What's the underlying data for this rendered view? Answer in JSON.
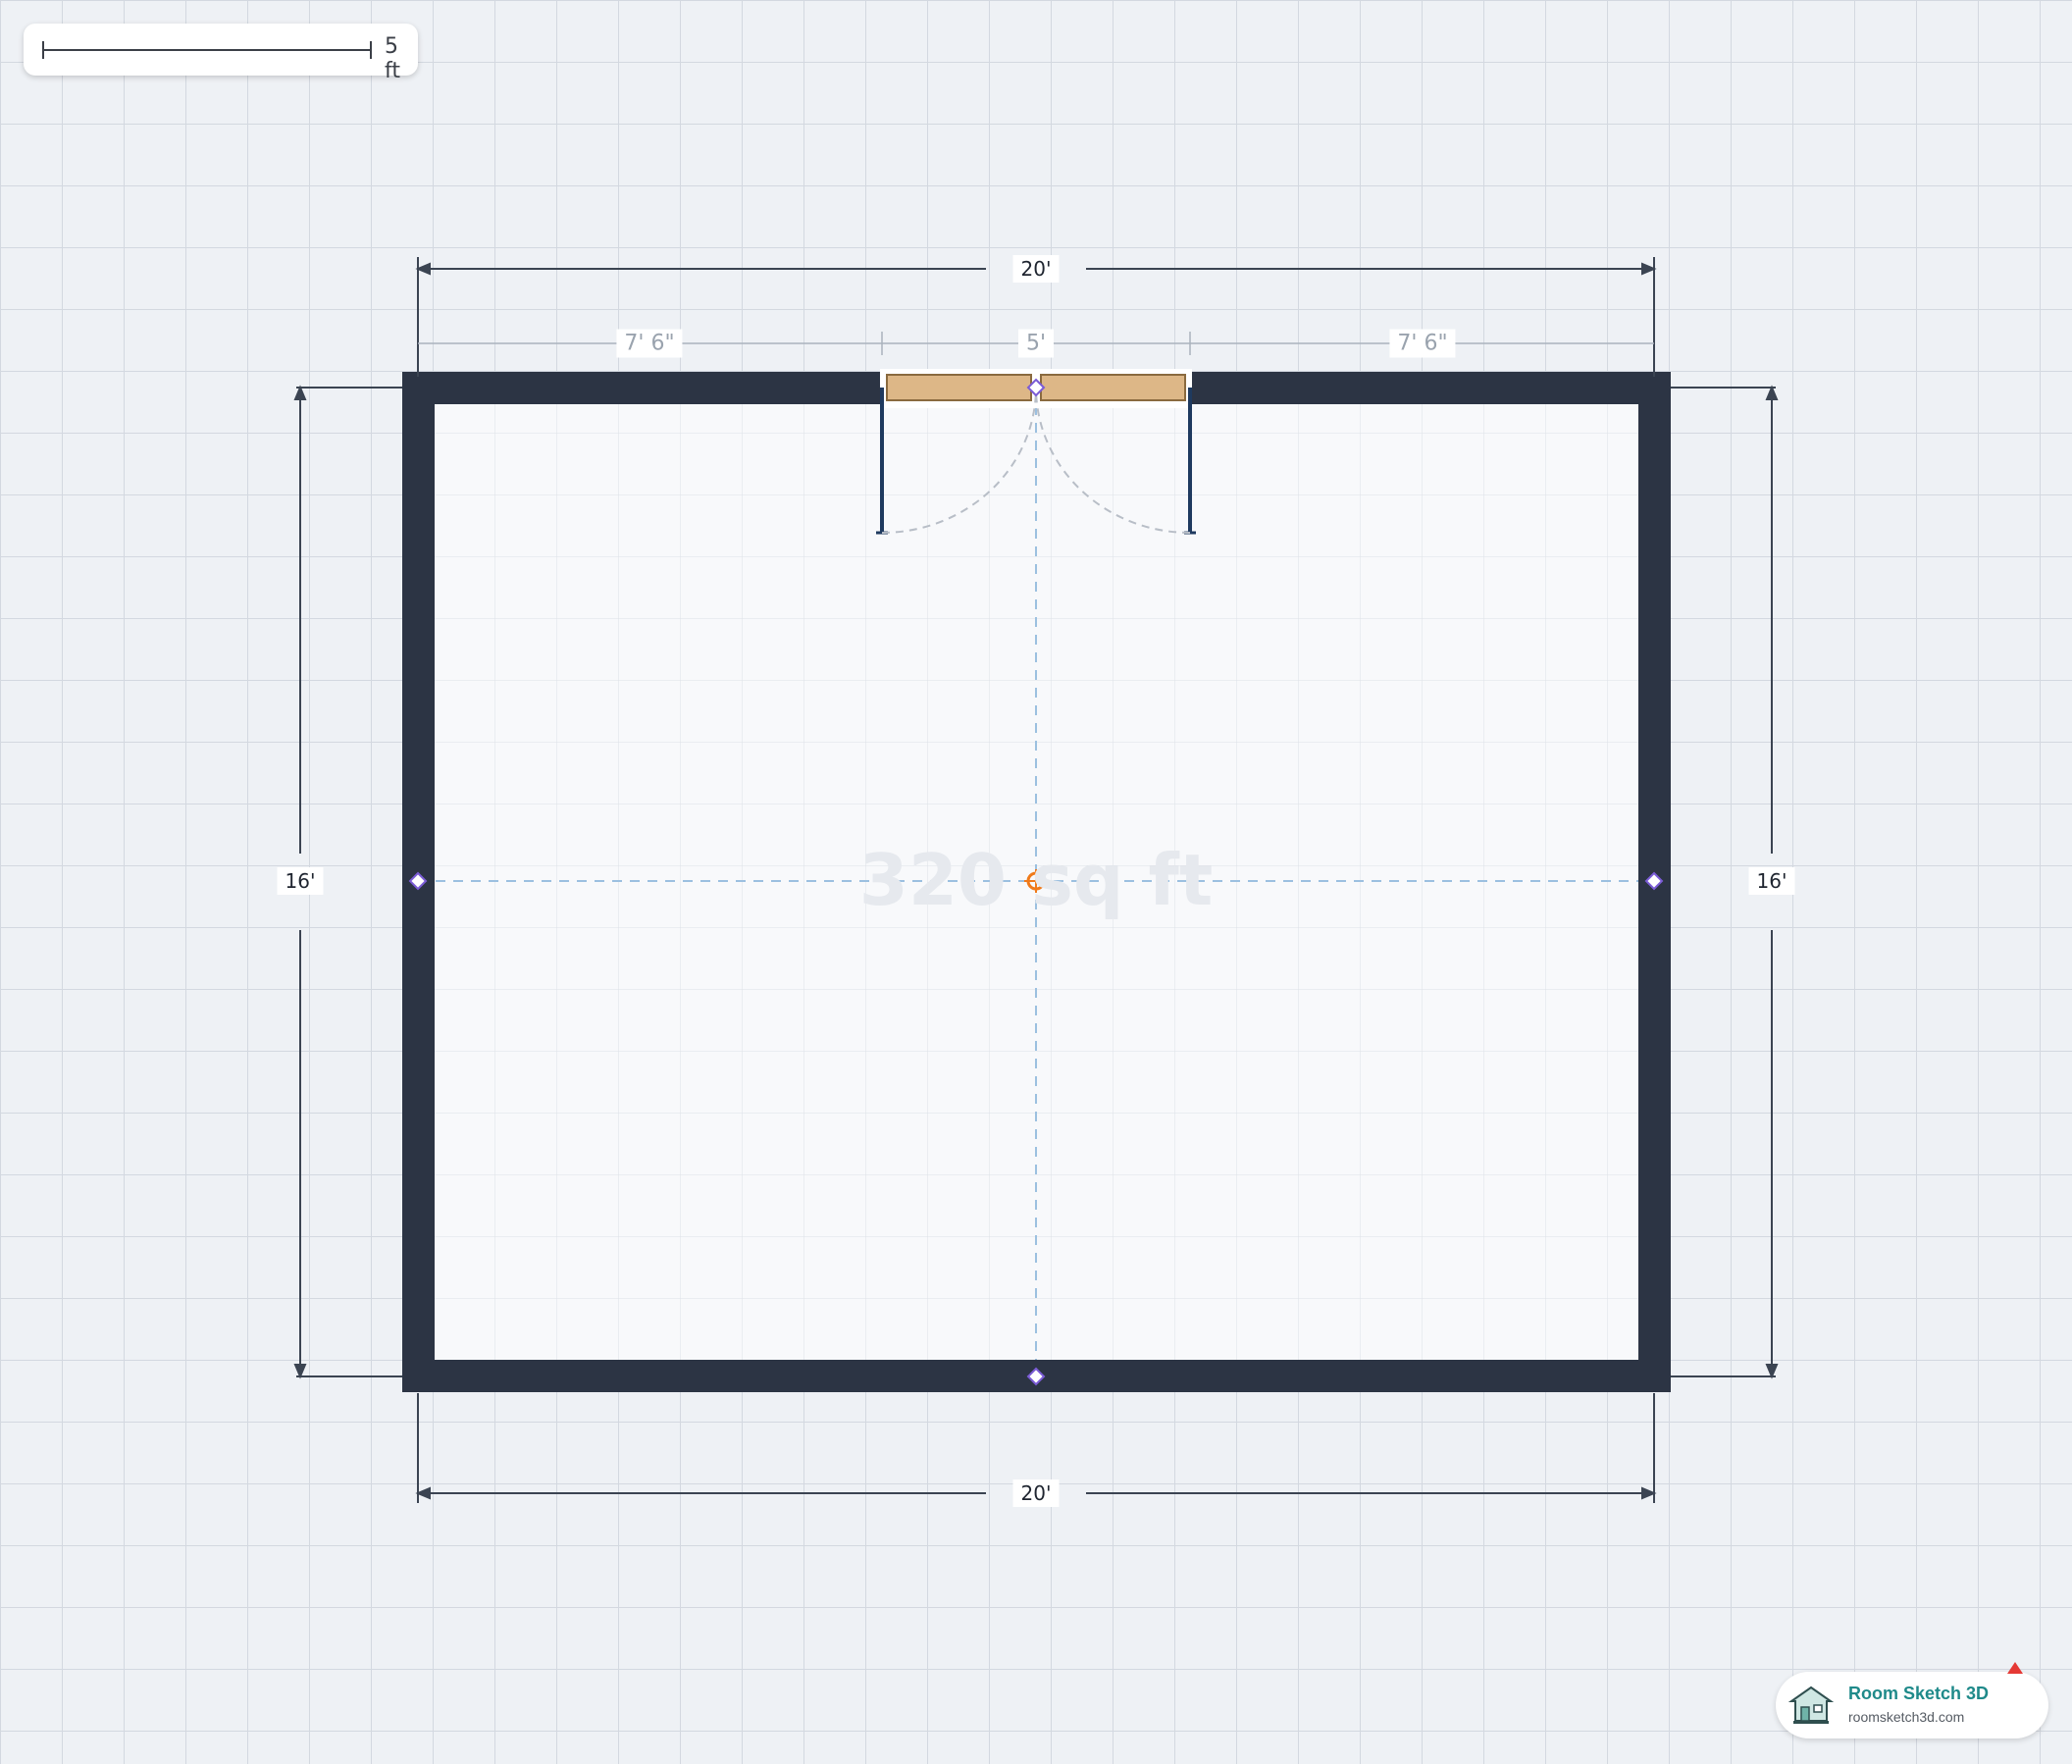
{
  "scale_bar": {
    "label": "5 ft"
  },
  "room": {
    "area_label": "320 sq ft",
    "wall_color": "#2c3444",
    "door_color": "#ddb787"
  },
  "dimensions": {
    "top_width": "20'",
    "bottom_width": "20'",
    "left_height": "16'",
    "right_height": "16'",
    "top_left_segment": "7' 6\"",
    "door_segment": "5'",
    "top_right_segment": "7' 6\""
  },
  "brand": {
    "name": "Room Sketch 3D",
    "url": "roomsketch3d.com"
  }
}
